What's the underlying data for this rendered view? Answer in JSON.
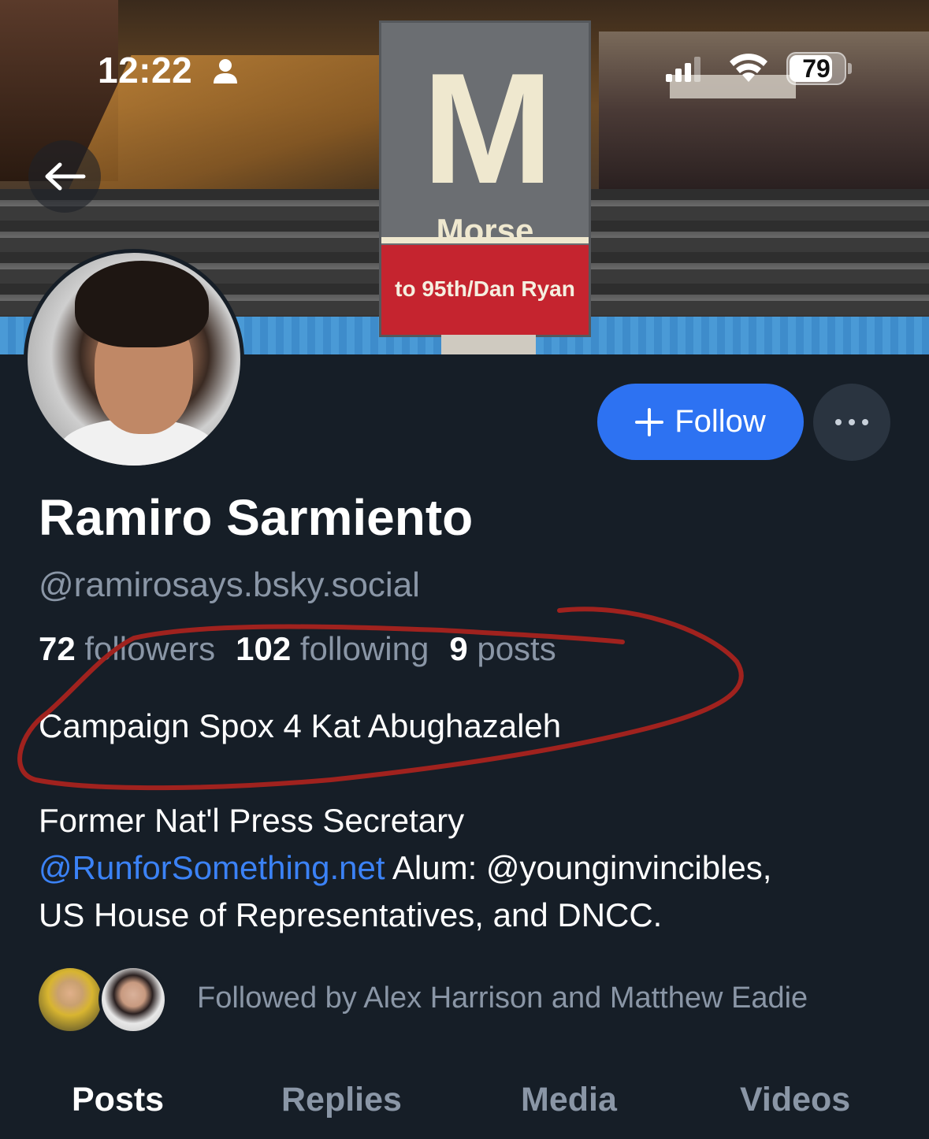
{
  "status_bar": {
    "time": "12:22",
    "battery": "79",
    "battery_level": 0.79
  },
  "banner": {
    "sign_letter": "M",
    "station": "Morse",
    "destination": "to 95th/Dan Ryan"
  },
  "actions": {
    "follow_label": "Follow",
    "more_label": "···"
  },
  "profile": {
    "display_name": "Ramiro Sarmiento",
    "handle": "@ramirosays.bsky.social",
    "stats": {
      "followers_count": "72",
      "followers_label": "followers",
      "following_count": "102",
      "following_label": "following",
      "posts_count": "9",
      "posts_label": "posts"
    },
    "bio": {
      "line1": "Campaign Spox 4 Kat Abughazaleh",
      "line2": "Former Nat'l Press Secretary",
      "link": "@RunforSomething.net",
      "rest_line3": " Alum: @younginvincibles,",
      "line4": "US House of Representatives, and DNCC."
    },
    "followed_by": "Followed by Alex Harrison and Matthew Eadie"
  },
  "tabs": [
    {
      "label": "Posts",
      "active": true
    },
    {
      "label": "Replies",
      "active": false
    },
    {
      "label": "Media",
      "active": false
    },
    {
      "label": "Videos",
      "active": false
    }
  ],
  "colors": {
    "background": "#161e27",
    "accent": "#2d72f2",
    "link": "#3b82f6",
    "muted_text": "#8a96a6",
    "annotation": "#a0221e"
  },
  "icons": [
    "person-icon",
    "signal-icon",
    "wifi-icon",
    "back-arrow-icon",
    "plus-icon",
    "more-icon"
  ]
}
